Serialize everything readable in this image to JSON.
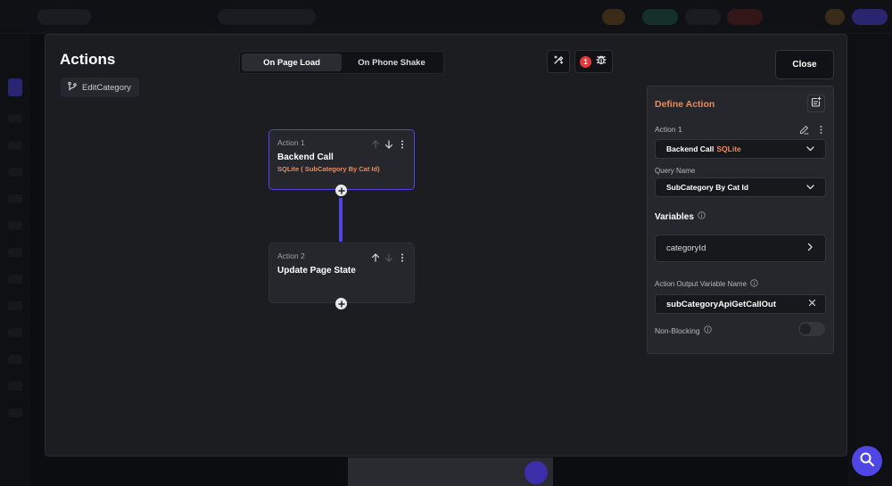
{
  "modal": {
    "title": "Actions",
    "chip_label": "EditCategory",
    "tabs": [
      {
        "label": "On Page Load",
        "active": true
      },
      {
        "label": "On Phone Shake",
        "active": false
      }
    ],
    "issues_count": "1",
    "close_label": "Close"
  },
  "actions": [
    {
      "index_label": "Action 1",
      "title": "Backend Call",
      "subtitle": "SQLite ( SubCategory By Cat Id)",
      "selected": true
    },
    {
      "index_label": "Action 2",
      "title": "Update Page State",
      "subtitle": "",
      "selected": false
    }
  ],
  "panel": {
    "title": "Define Action",
    "action_label": "Action 1",
    "action_type": "Backend Call",
    "action_type_accent": "SQLite",
    "query_name_label": "Query Name",
    "query_name_value": "SubCategory By Cat Id",
    "variables_label": "Variables",
    "variable_item": "categoryId",
    "output_var_label": "Action Output Variable Name",
    "output_var_value": "subCategoryApiGetCallOut",
    "non_blocking_label": "Non-Blocking",
    "non_blocking": false
  },
  "colors": {
    "accent": "#4f46e5",
    "orange": "#ee8a5a",
    "panel_bg": "#25272c",
    "modal_bg": "#1b1d21"
  },
  "icons": {
    "chip": "branch-icon",
    "flow": "magic-wand-icon",
    "issues": "bug-icon",
    "edit": "pencil-icon",
    "more": "more-vertical-icon",
    "chevron": "chevron-down-icon",
    "fab": "search-icon"
  }
}
